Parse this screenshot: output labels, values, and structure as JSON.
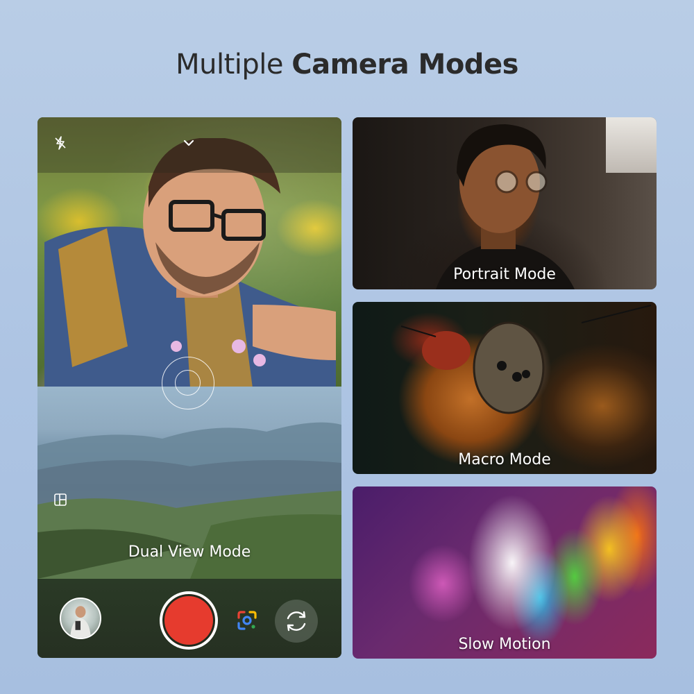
{
  "header": {
    "title_light": "Multiple ",
    "title_bold": "Camera Modes"
  },
  "phone": {
    "top_bar": {
      "flash_icon": "flash-off-icon",
      "collapse_icon": "chevron-down-icon"
    },
    "dual_view": {
      "layout_icon": "split-layout-icon",
      "label": "Dual View Mode"
    },
    "controls": {
      "gallery": "gallery-thumbnail",
      "shutter": "record-button",
      "lens": "google-lens-icon",
      "switch": "switch-camera-icon",
      "shutter_color": "#e63b2e"
    }
  },
  "cards": {
    "portrait": "Portrait Mode",
    "macro": "Macro Mode",
    "slowmo": "Slow Motion"
  }
}
